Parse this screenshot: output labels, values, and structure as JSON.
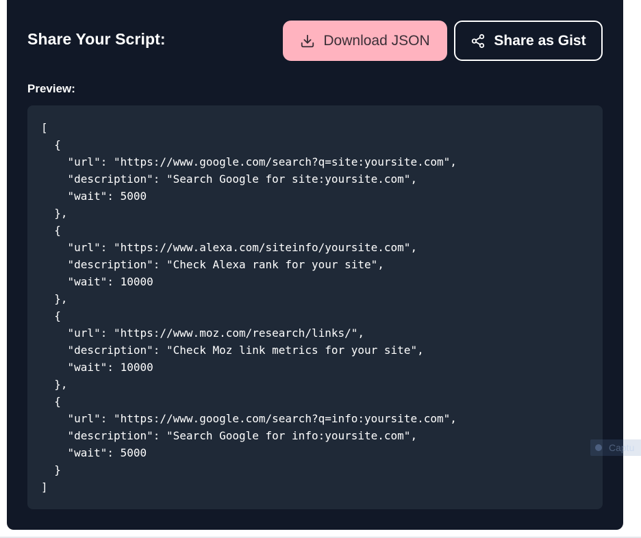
{
  "header": {
    "title": "Share Your Script:",
    "download_label": "Download JSON",
    "gist_label": "Share as Gist"
  },
  "preview": {
    "label": "Preview:",
    "code": "[\n  {\n    \"url\": \"https://www.google.com/search?q=site:yoursite.com\",\n    \"description\": \"Search Google for site:yoursite.com\",\n    \"wait\": 5000\n  },\n  {\n    \"url\": \"https://www.alexa.com/siteinfo/yoursite.com\",\n    \"description\": \"Check Alexa rank for your site\",\n    \"wait\": 10000\n  },\n  {\n    \"url\": \"https://www.moz.com/research/links/\",\n    \"description\": \"Check Moz link metrics for your site\",\n    \"wait\": 10000\n  },\n  {\n    \"url\": \"https://www.google.com/search?q=info:yoursite.com\",\n    \"description\": \"Search Google for info:yoursite.com\",\n    \"wait\": 5000\n  }\n]"
  },
  "overlay": {
    "text": "Captu"
  },
  "icons": {
    "download": "download-icon",
    "share": "share-icon"
  },
  "colors": {
    "card_bg": "#111827",
    "code_bg": "#1f2937",
    "download_bg": "#ffb3bf"
  }
}
